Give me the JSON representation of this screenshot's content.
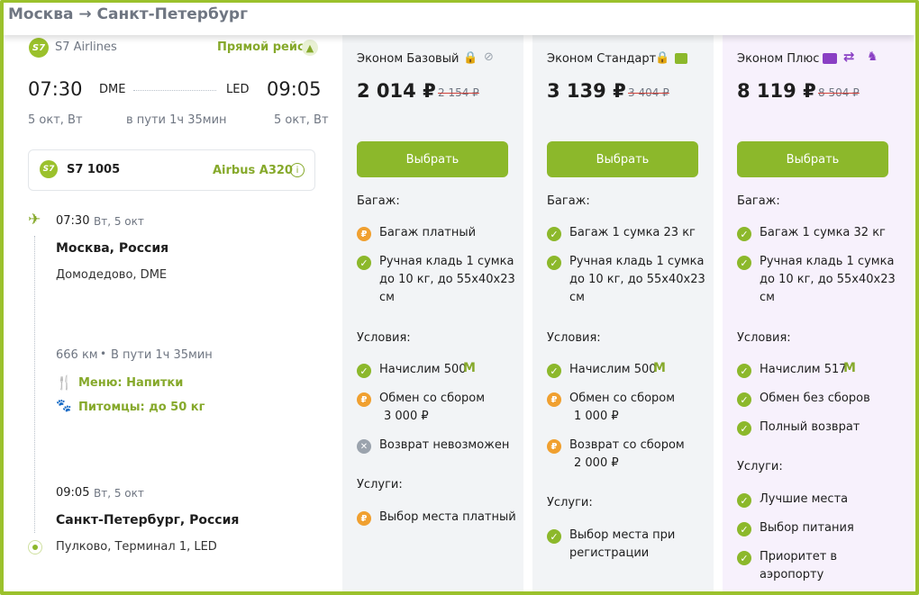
{
  "route": "Москва → Санкт-Петербург",
  "flight": {
    "airline": "S7 Airlines",
    "logo_text": "S7",
    "direct_label": "Прямой рейс",
    "dep_time": "07:30",
    "dep_code": "DME",
    "arr_code": "LED",
    "arr_time": "09:05",
    "dep_date": "5 окт, Вт",
    "duration": "в пути 1ч 35мин",
    "arr_date": "5 окт, Вт",
    "number": "S7 1005",
    "aircraft": "Airbus A320",
    "dep_detail_time": "07:30",
    "dep_detail_date": "Вт, 5 окт",
    "dep_city": "Москва, Россия",
    "dep_airport": "Домодедово, DME",
    "distance": "666 км",
    "detail_duration": "В пути 1ч 35мин",
    "menu": "Меню: Напитки",
    "pets": "Питомцы: до 50 кг",
    "arr_detail_time": "09:05",
    "arr_detail_date": "Вт, 5 окт",
    "arr_city": "Санкт-Петербург, Россия",
    "arr_airport": "Пулково, Терминал 1, LED"
  },
  "fares": [
    {
      "name": "Эконом Базовый",
      "price": "2 014 ₽",
      "old_price": "2 154 ₽",
      "button": "Выбрать",
      "baggage_title": "Багаж:",
      "baggage": [
        "Багаж платный",
        "Ручная кладь 1 сумка",
        "до 10 кг, до 55х40х23",
        "см"
      ],
      "conditions_title": "Условия:",
      "conditions": [
        "Начислим 500",
        "Обмен со сбором",
        "3 000 ₽",
        "Возврат невозможен"
      ],
      "services_title": "Услуги:",
      "services": [
        "Выбор места платный"
      ]
    },
    {
      "name": "Эконом Стандарт",
      "price": "3 139 ₽",
      "old_price": "3 404 ₽",
      "button": "Выбрать",
      "baggage_title": "Багаж:",
      "baggage": [
        "Багаж 1 сумка 23 кг",
        "Ручная кладь 1 сумка",
        "до 10 кг, до 55х40х23",
        "см"
      ],
      "conditions_title": "Условия:",
      "conditions": [
        "Начислим 500",
        "Обмен со сбором",
        "1 000 ₽",
        "Возврат со сбором",
        "2 000 ₽"
      ],
      "services_title": "Услуги:",
      "services": [
        "Выбор места при",
        "регистрации"
      ]
    },
    {
      "name": "Эконом Плюс",
      "price": "8 119 ₽",
      "old_price": "8 504 ₽",
      "button": "Выбрать",
      "baggage_title": "Багаж:",
      "baggage": [
        "Багаж 1 сумка 32 кг",
        "Ручная кладь 1 сумка",
        "до 10 кг, до 55х40х23",
        "см"
      ],
      "conditions_title": "Условия:",
      "conditions": [
        "Начислим 517",
        "Обмен без сборов",
        "Полный возврат"
      ],
      "services_title": "Услуги:",
      "services": [
        "Лучшие места",
        "Выбор питания",
        "Приоритет в",
        "аэропорту"
      ]
    }
  ],
  "colors": {
    "accent": "#8cb82b",
    "paid": "#f0a030",
    "disabled": "#9ba3ad",
    "plus_icons": "#8a3fc4"
  }
}
